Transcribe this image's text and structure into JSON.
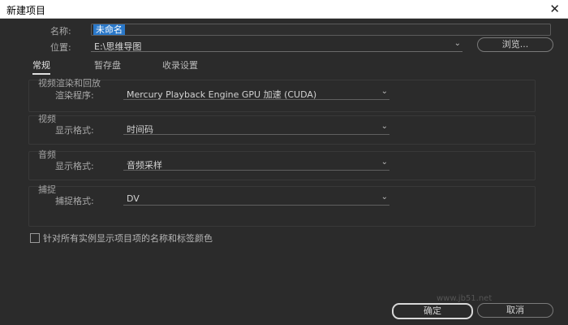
{
  "window": {
    "title": "新建项目",
    "close_glyph": "✕"
  },
  "name_field": {
    "label": "名称:",
    "value": "未命名"
  },
  "location": {
    "label": "位置:",
    "value": "E:\\思维导图",
    "browse_label": "浏览..."
  },
  "tabs": [
    {
      "label": "常规",
      "active": true
    },
    {
      "label": "暂存盘",
      "active": false
    },
    {
      "label": "收录设置",
      "active": false
    }
  ],
  "groups": {
    "render": {
      "title": "视频渲染和回放",
      "field_label": "渲染程序:",
      "value": "Mercury Playback Engine GPU 加速 (CUDA)"
    },
    "video": {
      "title": "视频",
      "field_label": "显示格式:",
      "value": "时间码"
    },
    "audio": {
      "title": "音频",
      "field_label": "显示格式:",
      "value": "音频采样"
    },
    "capture": {
      "title": "捕捉",
      "field_label": "捕捉格式:",
      "value": "DV"
    }
  },
  "checkbox": {
    "label": "针对所有实例显示项目项的名称和标签颜色",
    "checked": false
  },
  "buttons": {
    "ok": "确定",
    "cancel": "取消"
  },
  "watermark": "www.jb51.net",
  "icons": {
    "dropdown": "chevron-down-icon",
    "close": "close-icon"
  },
  "colors": {
    "background": "#2b2b2b",
    "selection": "#2a78c9",
    "titlebar": "#ffffff"
  }
}
